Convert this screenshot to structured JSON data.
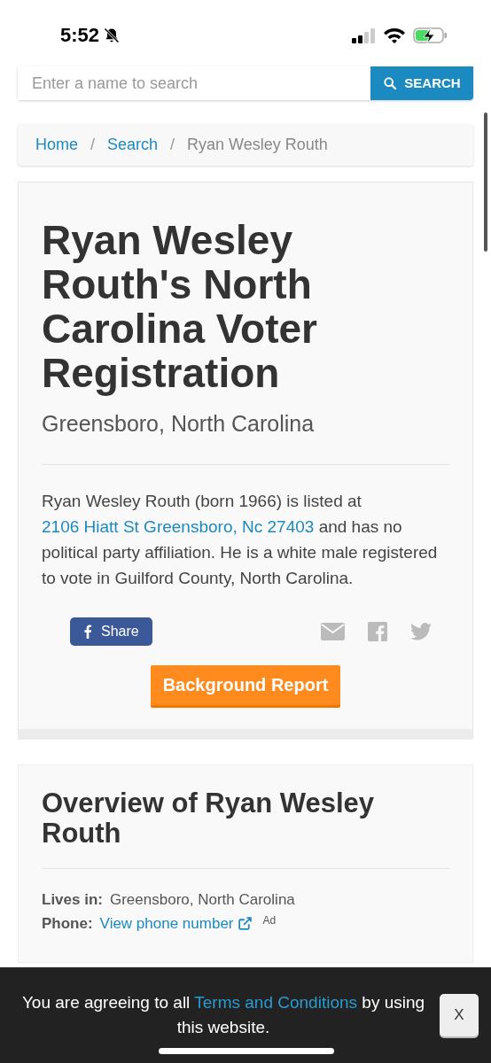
{
  "status_bar": {
    "time": "5:52",
    "silent": true
  },
  "search": {
    "placeholder": "Enter a name to search",
    "button": "SEARCH"
  },
  "breadcrumb": [
    {
      "label": "Home",
      "link": true
    },
    {
      "label": "Search",
      "link": true
    },
    {
      "label": "Ryan Wesley Routh",
      "link": false
    }
  ],
  "breadcrumb_separator": "/",
  "profile": {
    "title": "Ryan Wesley Routh's North Carolina Voter Registration",
    "subtitle": "Greensboro, North Carolina",
    "summary": {
      "before": "Ryan Wesley Routh (born 1966) is listed at",
      "link": "2106 Hiatt St Greensboro, Nc 27403",
      "after": "and has no political party affiliation. He is a white male registered to vote in Guilford County, North Carolina."
    },
    "share_button": "Share",
    "report_button": "Background Report"
  },
  "overview": {
    "title": "Overview of Ryan Wesley Routh",
    "rows": [
      {
        "label": "Lives in:",
        "value": "Greensboro, North Carolina",
        "kind": "text"
      },
      {
        "label": "Phone:",
        "value": "View phone number",
        "kind": "link",
        "note": "Ad"
      }
    ]
  },
  "cookie_bar": {
    "before": "You are agreeing to all",
    "link": "Terms and Conditions",
    "after": "by using this website.",
    "close": "X"
  }
}
